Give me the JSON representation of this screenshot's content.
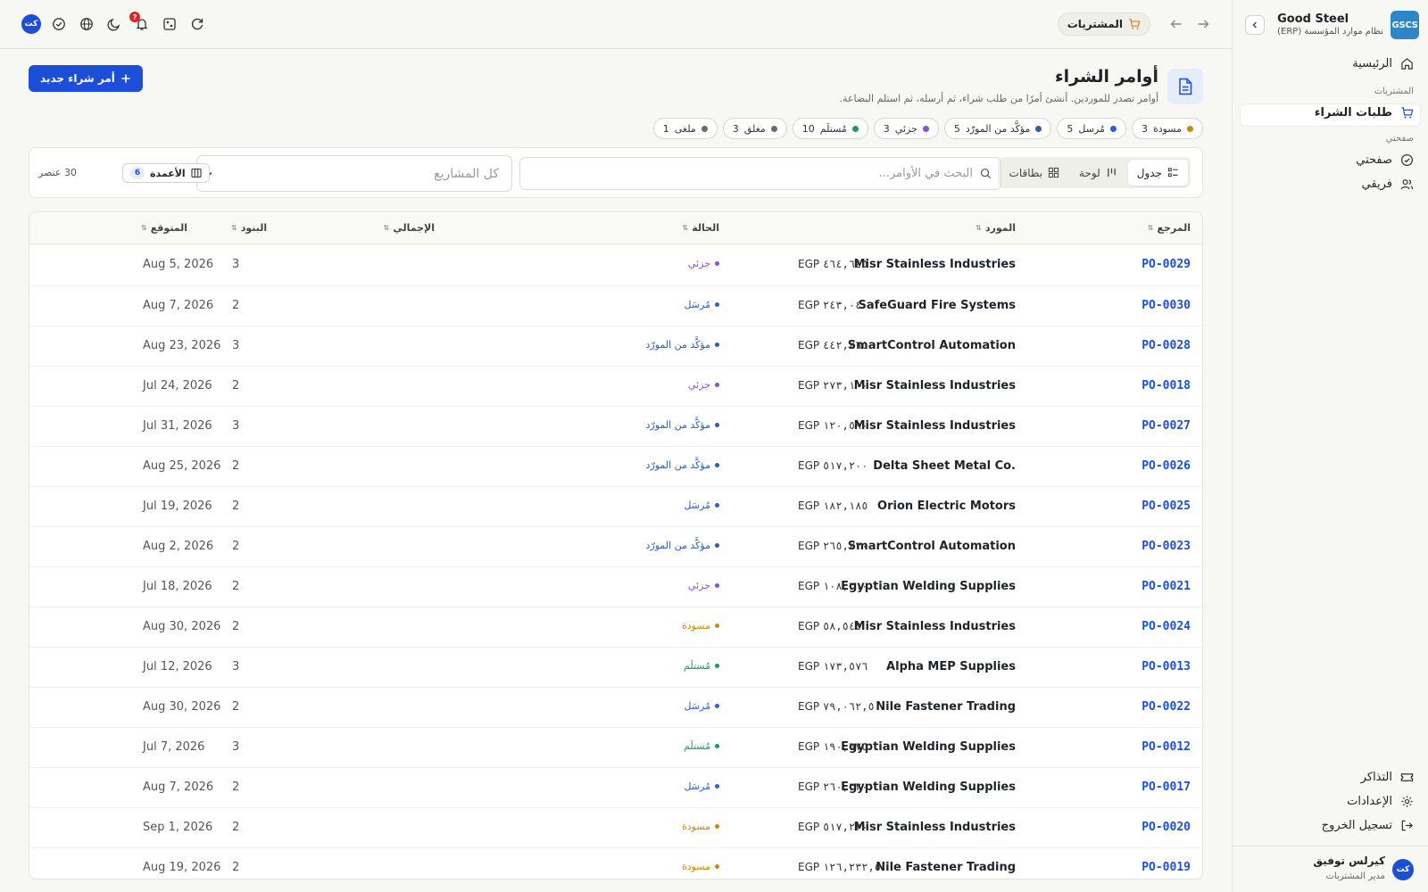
{
  "brand": {
    "name": "Good Steel",
    "subtitle": "نظام موارد المؤسسة (ERP)",
    "logo": "GSCS"
  },
  "sidebar": {
    "home": "الرئيسية",
    "section_procurement": "المشتريات",
    "purchase_requests": "طلبات الشراء",
    "section_mine": "صفحتي",
    "my_page": "صفحتي",
    "my_team": "فريقي",
    "tickets": "التذاكر",
    "settings": "الإعدادات",
    "logout": "تسجيل الخروج"
  },
  "user": {
    "initials": "كت",
    "name": "كيرلس توفيق",
    "role": "مدير المشتريات"
  },
  "topbar": {
    "section": "المشتريات",
    "avatar": "كت",
    "notif_badge": "?"
  },
  "page": {
    "title": "أوامر الشراء",
    "subtitle": "أوامر تصدر للموردين. أنشئ أمرًا من طلب شراء، ثم أرسله، ثم استلم البضاعة.",
    "new_button": "أمر شراء جديد"
  },
  "status_chips": [
    {
      "label": "مسودة",
      "count": "3",
      "color": "#c98a12"
    },
    {
      "label": "مُرسل",
      "count": "5",
      "color": "#2f5fd0"
    },
    {
      "label": "مؤكَّد من المورّد",
      "count": "5",
      "color": "#2f5fa8"
    },
    {
      "label": "جزئي",
      "count": "3",
      "color": "#8b4fd6"
    },
    {
      "label": "مُستلَم",
      "count": "10",
      "color": "#1e9a5a"
    },
    {
      "label": "مغلق",
      "count": "3",
      "color": "#6b6b6b"
    },
    {
      "label": "ملغى",
      "count": "1",
      "color": "#6b6b6b"
    }
  ],
  "toolbar": {
    "views": [
      "جدول",
      "لوحة",
      "بطاقات"
    ],
    "search_placeholder": "البحث في الأوامر...",
    "project_select": "كل المشاريع",
    "columns_label": "الأعمدة",
    "columns_count": "6",
    "items_count": "30 عنصر"
  },
  "table": {
    "headers": {
      "ref": "المرجع",
      "supplier": "المورد",
      "status": "الحالة",
      "total": "الإجمالي",
      "items": "البنود",
      "expected": "المتوقع"
    },
    "status_colors": {
      "جزئي": "#8b4fd6",
      "مُرسَل": "#2f5fd0",
      "مؤكَّد من المورّد": "#2f5fa8",
      "مسودة": "#c98a12",
      "مُستلَم": "#1e9a5a"
    },
    "rows": [
      {
        "ref": "PO-0029",
        "supplier": "Misr Stainless Industries",
        "status": "جزئي",
        "currency": "EGP",
        "total": "٤٦٤,٦٤٥",
        "items": "3",
        "expected": "Aug 5, 2026"
      },
      {
        "ref": "PO-0030",
        "supplier": "SafeGuard Fire Systems",
        "status": "مُرسَل",
        "currency": "EGP",
        "total": "٢٤٣,٠٤٠",
        "items": "2",
        "expected": "Aug 7, 2026"
      },
      {
        "ref": "PO-0028",
        "supplier": "SmartControl Automation",
        "status": "مؤكَّد من المورّد",
        "currency": "EGP",
        "total": "٤٤٢,٢٦٥",
        "items": "3",
        "expected": "Aug 23, 2026"
      },
      {
        "ref": "PO-0018",
        "supplier": "Misr Stainless Industries",
        "status": "جزئي",
        "currency": "EGP",
        "total": "٢٧٣,١٠٠",
        "items": "2",
        "expected": "Jul 24, 2026"
      },
      {
        "ref": "PO-0027",
        "supplier": "Misr Stainless Industries",
        "status": "مؤكَّد من المورّد",
        "currency": "EGP",
        "total": "١٢٠,٥٩٠",
        "items": "3",
        "expected": "Jul 31, 2026"
      },
      {
        "ref": "PO-0026",
        "supplier": "Delta Sheet Metal Co.",
        "status": "مؤكَّد من المورّد",
        "currency": "EGP",
        "total": "٥١٧,٢٠٠",
        "items": "2",
        "expected": "Aug 25, 2026"
      },
      {
        "ref": "PO-0025",
        "supplier": "Orion Electric Motors",
        "status": "مُرسَل",
        "currency": "EGP",
        "total": "١٨٢,١٨٥",
        "items": "2",
        "expected": "Jul 19, 2026"
      },
      {
        "ref": "PO-0023",
        "supplier": "SmartControl Automation",
        "status": "مؤكَّد من المورّد",
        "currency": "EGP",
        "total": "٢٦٥,٢٣٠",
        "items": "2",
        "expected": "Aug 2, 2026"
      },
      {
        "ref": "PO-0021",
        "supplier": "Egyptian Welding Supplies",
        "status": "جزئي",
        "currency": "EGP",
        "total": "١٠٨,٢١٠",
        "items": "2",
        "expected": "Jul 18, 2026"
      },
      {
        "ref": "PO-0024",
        "supplier": "Misr Stainless Industries",
        "status": "مسودة",
        "currency": "EGP",
        "total": "٥٨,٥٤٥",
        "items": "2",
        "expected": "Aug 30, 2026"
      },
      {
        "ref": "PO-0013",
        "supplier": "Alpha MEP Supplies",
        "status": "مُستلَم",
        "currency": "EGP",
        "total": "١٧٣,٥٧٦",
        "items": "3",
        "expected": "Jul 12, 2026"
      },
      {
        "ref": "PO-0022",
        "supplier": "Nile Fastener Trading",
        "status": "مُرسَل",
        "currency": "EGP",
        "total": "٧٩,٠٦٢,٥",
        "items": "2",
        "expected": "Aug 30, 2026"
      },
      {
        "ref": "PO-0012",
        "supplier": "Egyptian Welding Supplies",
        "status": "مُستلَم",
        "currency": "EGP",
        "total": "١٩٠,٦٧٥",
        "items": "3",
        "expected": "Jul 7, 2026"
      },
      {
        "ref": "PO-0017",
        "supplier": "Egyptian Welding Supplies",
        "status": "مُرسَل",
        "currency": "EGP",
        "total": "٢٦٠,٢٢٠",
        "items": "2",
        "expected": "Aug 7, 2026"
      },
      {
        "ref": "PO-0020",
        "supplier": "Misr Stainless Industries",
        "status": "مسودة",
        "currency": "EGP",
        "total": "٥١٧,٢٢٠",
        "items": "2",
        "expected": "Sep 1, 2026"
      },
      {
        "ref": "PO-0019",
        "supplier": "Nile Fastener Trading",
        "status": "مسودة",
        "currency": "EGP",
        "total": "١٢٦,٢٣٢,٥",
        "items": "2",
        "expected": "Aug 19, 2026"
      }
    ]
  }
}
